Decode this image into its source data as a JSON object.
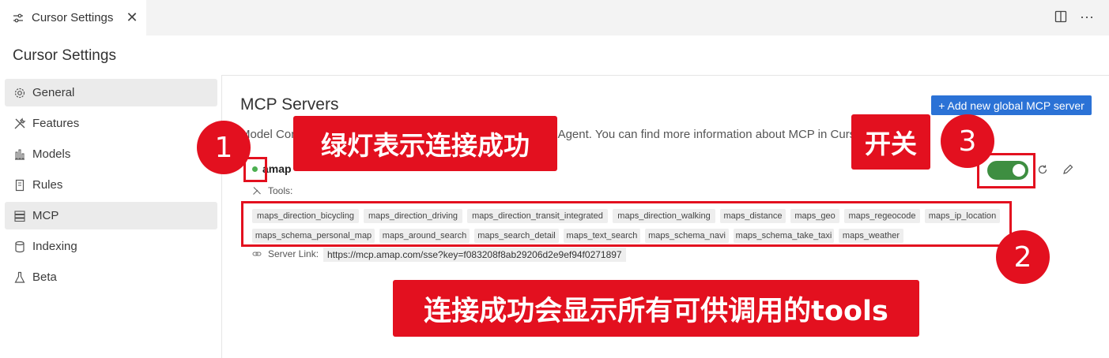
{
  "tab": {
    "title": "Cursor Settings",
    "close": "✕",
    "more": "···"
  },
  "page_title": "Cursor Settings",
  "sidebar": {
    "items": [
      {
        "label": "General",
        "icon": "gear-icon"
      },
      {
        "label": "Features",
        "icon": "tools-icon"
      },
      {
        "label": "Models",
        "icon": "chart-icon"
      },
      {
        "label": "Rules",
        "icon": "book-icon"
      },
      {
        "label": "MCP",
        "icon": "server-icon"
      },
      {
        "label": "Indexing",
        "icon": "database-icon"
      },
      {
        "label": "Beta",
        "icon": "flask-icon"
      }
    ],
    "active": "MCP"
  },
  "main": {
    "heading": "MCP Servers",
    "add_button": "+ Add new global MCP server",
    "description": "Model Context Protocol is a way to offer new tools to Cursor Agent. You can find more information about MCP in Cursor docs.",
    "server": {
      "name": "amap",
      "status_color": "#4caf50",
      "tools_label": "Tools:",
      "tools": [
        "maps_direction_bicycling",
        "maps_direction_driving",
        "maps_direction_transit_integrated",
        "maps_direction_walking",
        "maps_distance",
        "maps_geo",
        "maps_regeocode",
        "maps_ip_location",
        "maps_schema_personal_map",
        "maps_around_search",
        "maps_search_detail",
        "maps_text_search",
        "maps_schema_navi",
        "maps_schema_take_taxi",
        "maps_weather"
      ],
      "link_label": "Server Link:",
      "link": "https://mcp.amap.com/sse?key=f083208f8ab29206d2e9ef94f0271897",
      "enabled": true
    }
  },
  "annotations": {
    "n1": "1",
    "n2": "2",
    "n3": "3",
    "green_light": "绿灯表示连接成功",
    "switch": "开关",
    "tools_note": "连接成功会显示所有可供调用的tools"
  },
  "colors": {
    "accent": "#2b72d6",
    "annotation": "#e3101f",
    "toggle_on": "#3e8e41"
  }
}
